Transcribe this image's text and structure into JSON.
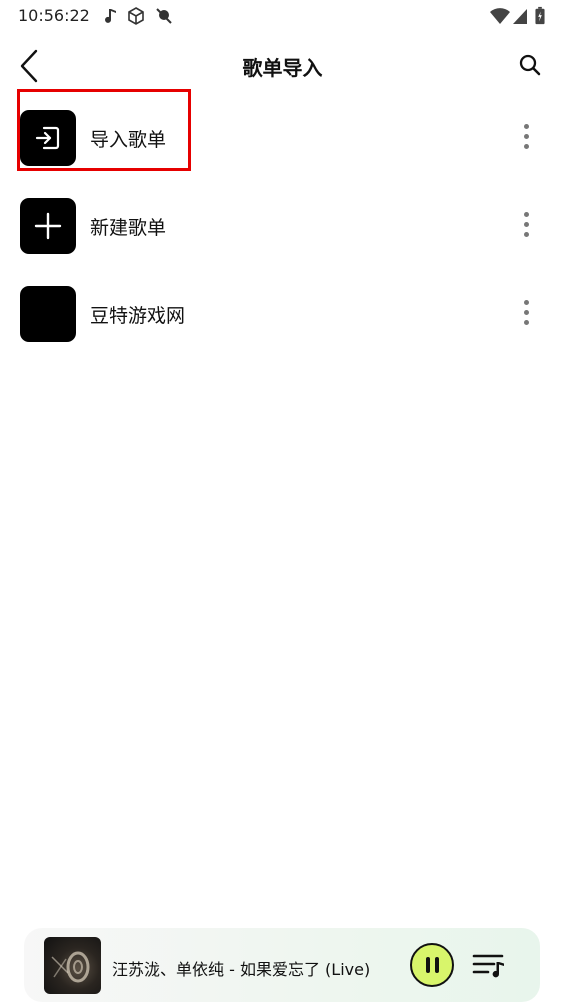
{
  "status_bar": {
    "time": "10:56:22",
    "icons": [
      "music-note-icon",
      "cube-icon",
      "location-off-icon",
      "wifi-icon",
      "signal-icon",
      "battery-icon"
    ]
  },
  "header": {
    "title": "歌单导入",
    "back_icon": "back-chevron-icon",
    "search_icon": "search-icon"
  },
  "list": {
    "items": [
      {
        "label": "导入歌单",
        "icon": "import-icon"
      },
      {
        "label": "新建歌单",
        "icon": "plus-icon"
      },
      {
        "label": "豆特游戏网",
        "icon": "playlist-cover"
      }
    ]
  },
  "player": {
    "track": "汪苏泷、单依纯 - 如果爱忘了 (Live)",
    "accent": "#d8f56b",
    "state": "playing"
  }
}
